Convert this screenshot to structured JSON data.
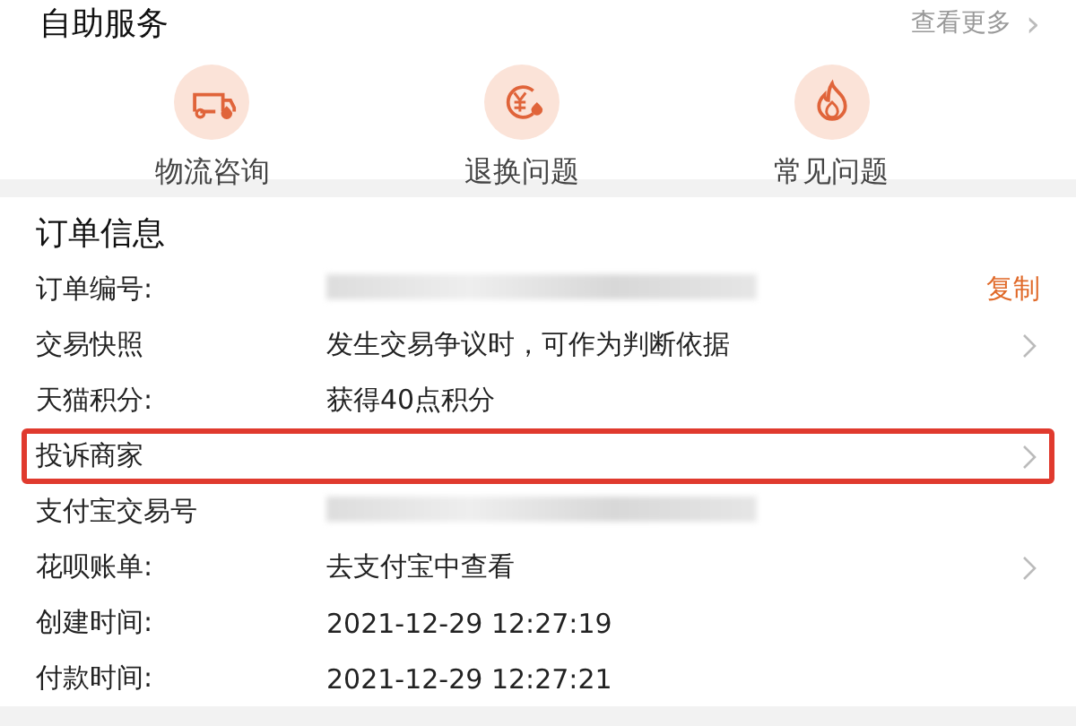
{
  "self_service": {
    "title": "自助服务",
    "more": "查看更多",
    "chevron": "›",
    "items": [
      {
        "label": "物流咨询"
      },
      {
        "label": "退换问题"
      },
      {
        "label": "常见问题"
      }
    ]
  },
  "order_info": {
    "title": "订单信息",
    "rows": [
      {
        "label": "订单编号:",
        "kind": "redacted",
        "action": "复制",
        "highlighted": false
      },
      {
        "label": "交易快照",
        "kind": "text",
        "value": "发生交易争议时，可作为判断依据",
        "chevron": true,
        "highlighted": false
      },
      {
        "label": "天猫积分:",
        "kind": "text",
        "value": "获得40点积分",
        "chevron": false,
        "highlighted": false
      },
      {
        "label": "投诉商家",
        "kind": "text",
        "chevron": true,
        "highlighted": true
      },
      {
        "label": "支付宝交易号",
        "kind": "redacted",
        "highlighted": false
      },
      {
        "label": "花呗账单:",
        "kind": "text",
        "value": "去支付宝中查看",
        "chevron": true,
        "highlighted": false
      },
      {
        "label": "创建时间:",
        "kind": "text",
        "value": "2021-12-29 12:27:19",
        "chevron": false,
        "highlighted": false
      },
      {
        "label": "付款时间:",
        "kind": "text",
        "value": "2021-12-29 12:27:21",
        "chevron": false,
        "highlighted": false
      }
    ]
  }
}
